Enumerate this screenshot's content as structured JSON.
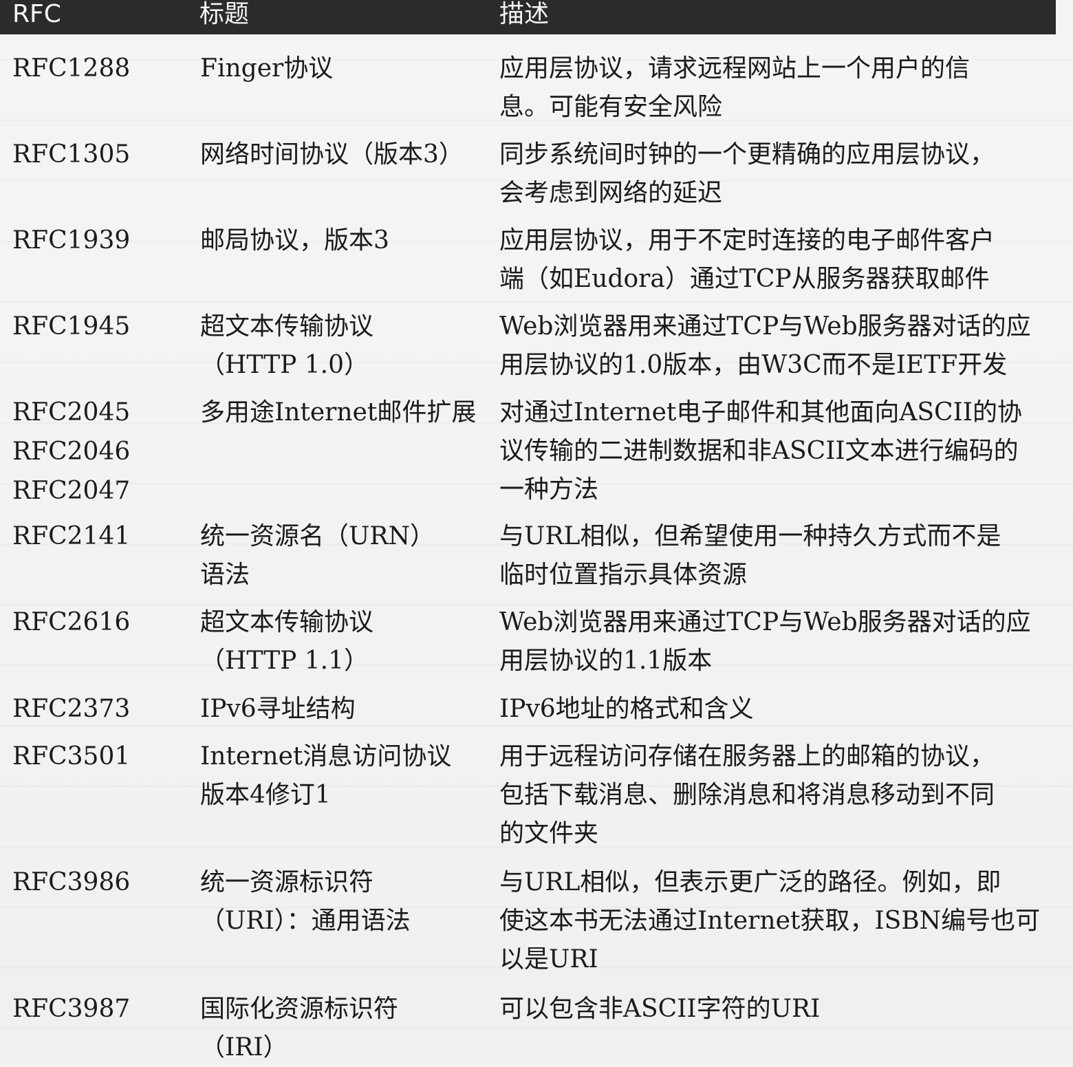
{
  "header": {
    "rfc": "RFC",
    "title": "标题",
    "desc": "描述"
  },
  "rows": [
    {
      "rfc": [
        "RFC1288"
      ],
      "title": "Finger协议",
      "desc": "应用层协议，请求远程网站上一个用户的信\n息。可能有安全风险"
    },
    {
      "rfc": [
        "RFC1305"
      ],
      "title": "网络时间协议（版本3）",
      "desc": "同步系统间时钟的一个更精确的应用层协议，\n会考虑到网络的延迟"
    },
    {
      "rfc": [
        "RFC1939"
      ],
      "title": "邮局协议，版本3",
      "desc": "应用层协议，用于不定时连接的电子邮件客户\n端（如Eudora）通过TCP从服务器获取邮件"
    },
    {
      "rfc": [
        "RFC1945"
      ],
      "title": "超文本传输协议\n（HTTP 1.0）",
      "desc": "Web浏览器用来通过TCP与Web服务器对话的应\n用层协议的1.0版本，由W3C而不是IETF开发"
    },
    {
      "rfc": [
        "RFC2045",
        "RFC2046",
        "RFC2047"
      ],
      "title": "多用途Internet邮件扩展",
      "desc": "对通过Internet电子邮件和其他面向ASCII的协\n议传输的二进制数据和非ASCII文本进行编码的\n一种方法"
    },
    {
      "rfc": [
        "RFC2141"
      ],
      "title": "统一资源名（URN）\n语法",
      "desc": "与URL相似，但希望使用一种持久方式而不是\n临时位置指示具体资源"
    },
    {
      "rfc": [
        "RFC2616"
      ],
      "title": "超文本传输协议\n（HTTP 1.1）",
      "desc": "Web浏览器用来通过TCP与Web服务器对话的应\n用层协议的1.1版本"
    },
    {
      "rfc": [
        "RFC2373"
      ],
      "title": "IPv6寻址结构",
      "desc": "IPv6地址的格式和含义"
    },
    {
      "rfc": [
        "RFC3501"
      ],
      "title": "Internet消息访问协议\n版本4修订1",
      "desc": "用于远程访问存储在服务器上的邮箱的协议，\n包括下载消息、删除消息和将消息移动到不同\n的文件夹"
    },
    {
      "rfc": [
        "RFC3986"
      ],
      "title": "统一资源标识符\n（URI）：通用语法",
      "desc": "与URL相似，但表示更广泛的路径。例如，即\n使这本书无法通过Internet获取，ISBN编号也可\n以是URI"
    },
    {
      "rfc": [
        "RFC3987"
      ],
      "title": "国际化资源标识符\n（IRI）",
      "desc": "可以包含非ASCII字符的URI"
    }
  ]
}
